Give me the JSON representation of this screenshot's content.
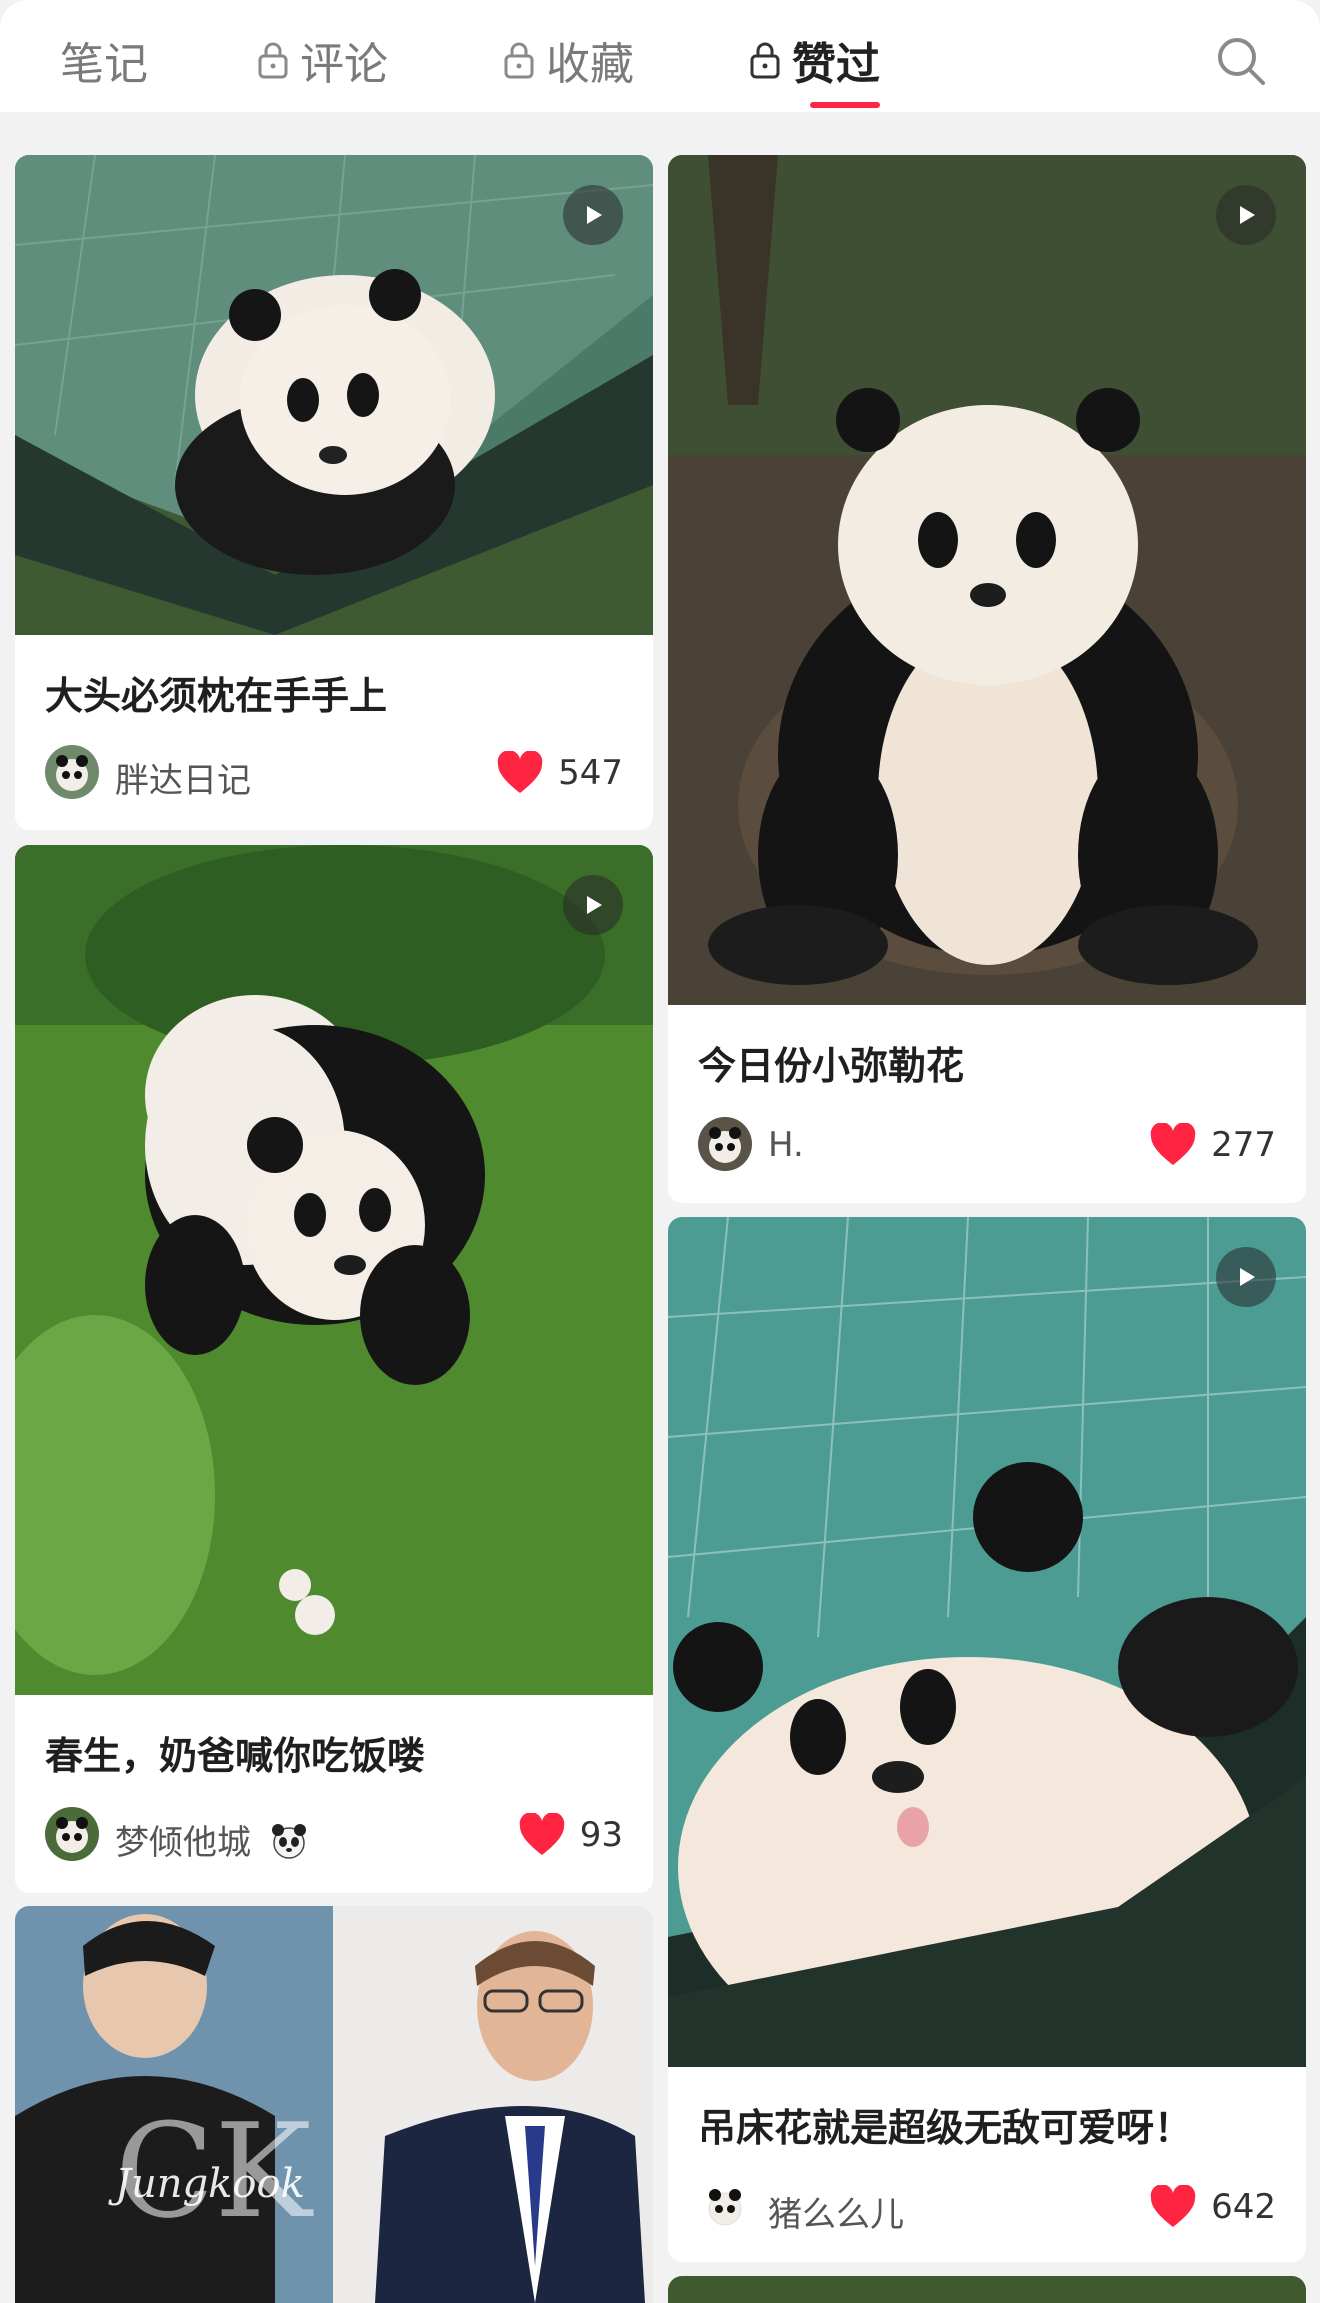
{
  "tabs": [
    {
      "label": "笔记",
      "locked": false,
      "active": false
    },
    {
      "label": "评论",
      "locked": true,
      "active": false
    },
    {
      "label": "收藏",
      "locked": true,
      "active": false
    },
    {
      "label": "赞过",
      "locked": true,
      "active": true
    }
  ],
  "accent_color": "#ff2442",
  "search_icon": "search-icon",
  "posts": [
    {
      "title": "大头必须枕在手手上",
      "author": "胖达日记",
      "likes": "547",
      "video": true
    },
    {
      "title": "今日份小弥勒花",
      "author": "H.",
      "likes": "277",
      "video": true
    },
    {
      "title": "春生，奶爸喊你吃饭喽",
      "author": "梦倾他城",
      "author_emoji": "panda-emoji",
      "likes": "93",
      "video": true
    },
    {
      "title": "吊床花就是超级无敌可爱呀！",
      "author": "猪么么儿",
      "likes": "642",
      "video": true
    },
    {
      "image_text": "Jungkook",
      "video": false
    }
  ]
}
